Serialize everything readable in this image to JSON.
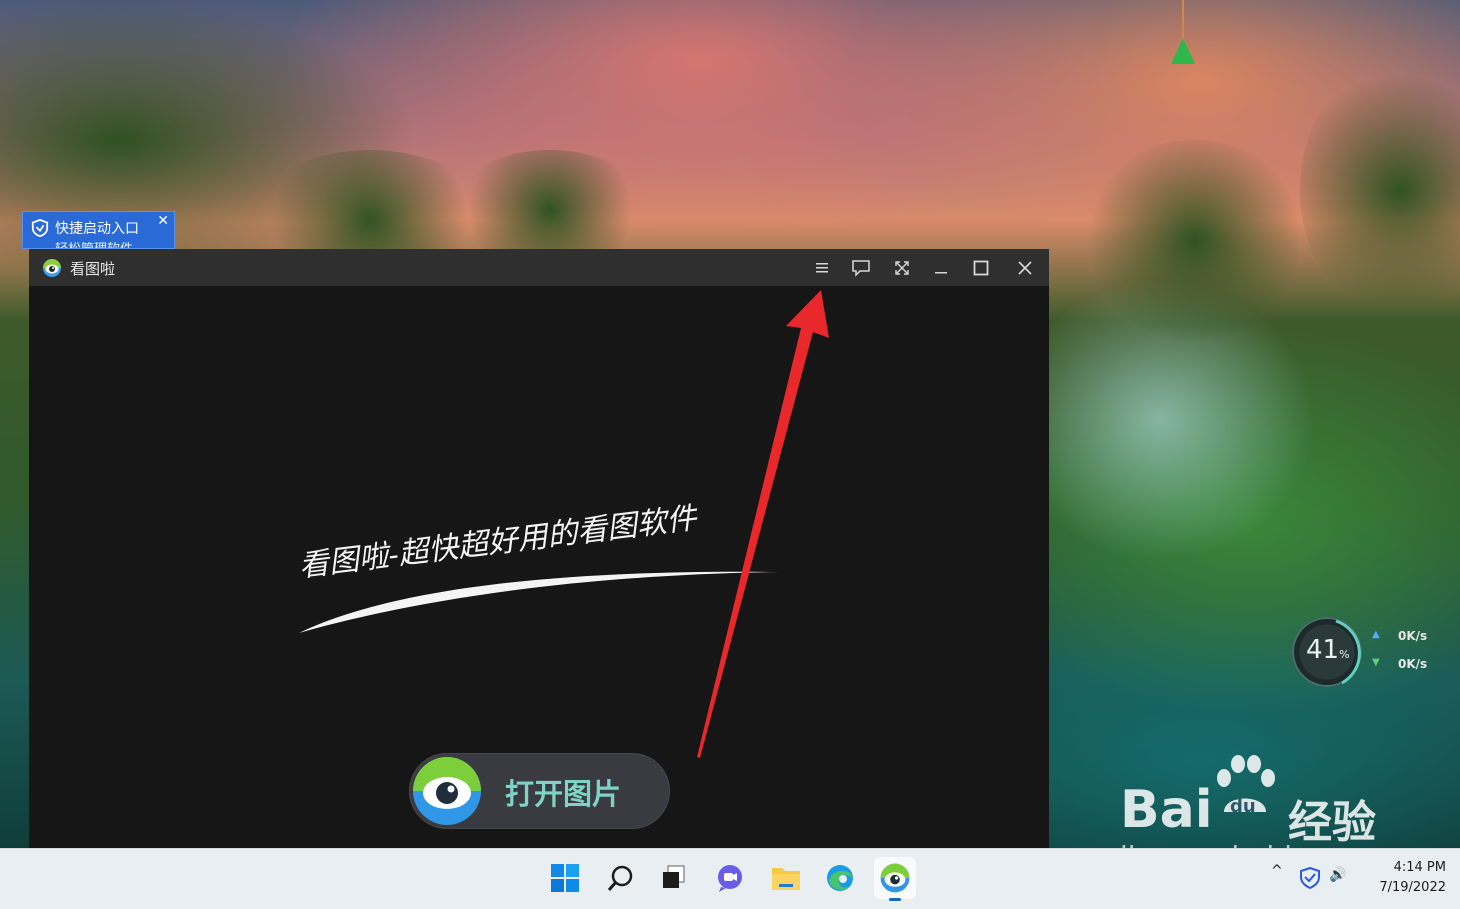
{
  "desktop": {
    "popup": {
      "title": "快捷启动入口",
      "subtitle": "轻松管理软件",
      "close_icon": "close-icon"
    },
    "network_widget": {
      "percent": "41",
      "percent_unit": "%",
      "upload": "0K/s",
      "download": "0K/s"
    },
    "watermark": {
      "brand_left": "Bai",
      "brand_right": "经验",
      "paw_text": "du",
      "url": "jingyan.baidu.com"
    }
  },
  "app": {
    "title": "看图啦",
    "titlebar_buttons": [
      "menu-icon",
      "feedback-icon",
      "fullscreen-icon",
      "minimize-icon",
      "maximize-icon",
      "close-icon"
    ],
    "slogan": "看图啦-超快超好用的看图软件",
    "open_button_label": "打开图片"
  },
  "annotation": {
    "arrow_color": "#e8282b",
    "points_to": "menu-icon"
  },
  "taskbar": {
    "icons": [
      "windows-start-icon",
      "search-icon",
      "task-view-icon",
      "chat-icon",
      "file-explorer-icon",
      "edge-icon",
      "kantula-app-icon"
    ],
    "tray": {
      "chevron": "^",
      "volume": "🔊"
    },
    "clock": {
      "time": "4:14 PM",
      "date": "7/19/2022"
    }
  },
  "colors": {
    "accent": "#0f6cbd",
    "titlebar": "#2f2f2f",
    "canvas": "#161616",
    "open_button_text": "#7fd2c6",
    "popup_bg": "#2a6ad6"
  }
}
